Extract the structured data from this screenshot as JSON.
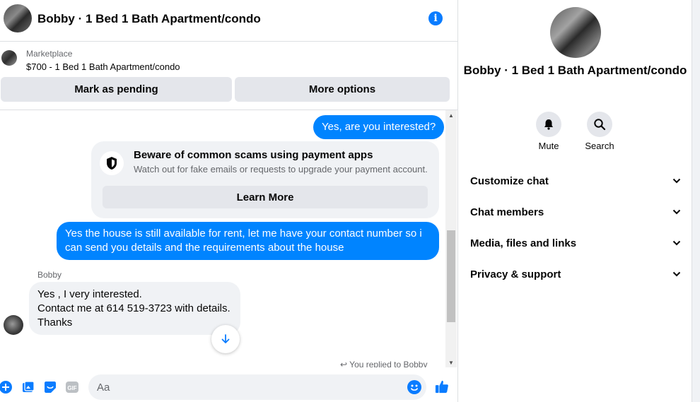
{
  "header": {
    "title": "Bobby · 1 Bed 1 Bath Apartment/condo",
    "info_icon": "info-icon"
  },
  "marketplace": {
    "label": "Marketplace",
    "item": "$700 - 1 Bed 1 Bath Apartment/condo",
    "pending_button": "Mark as pending",
    "more_button": "More options"
  },
  "messages": {
    "outgoing_1": "Yes, are you interested?",
    "scam_title": "Beware of common scams using payment apps",
    "scam_subtitle": "Watch out for fake emails or requests to upgrade your payment account.",
    "learn_more": "Learn More",
    "outgoing_2": "Yes the house is still available for rent, let me have your contact number so i can send you details and the requirements about the house",
    "sender_name": "Bobby",
    "incoming_lines": [
      "Yes , I very interested.",
      "Contact me at 614 519-3723 with details.",
      "Thanks"
    ],
    "replied_note": "You replied to Bobby"
  },
  "composer": {
    "placeholder": "Aa",
    "icons": [
      "plus-icon",
      "image-icon",
      "sticker-icon",
      "gif-icon",
      "emoji-icon",
      "like-icon"
    ],
    "gif_label": "GIF"
  },
  "details_panel": {
    "title": "Bobby · 1 Bed 1 Bath Apartment/condo",
    "mute_label": "Mute",
    "search_label": "Search",
    "sections": [
      "Customize chat",
      "Chat members",
      "Media, files and links",
      "Privacy & support"
    ]
  },
  "colors": {
    "accent": "#0084ff",
    "bubble_in": "#f0f2f5",
    "button_gray": "#e4e6eb",
    "secondary_text": "#65676b"
  }
}
